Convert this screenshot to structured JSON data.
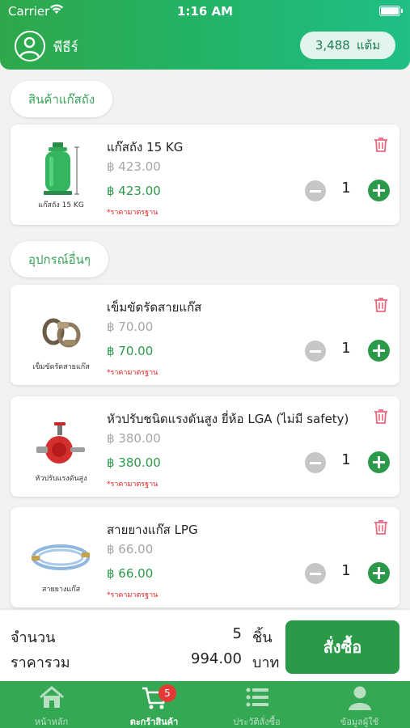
{
  "status_bar": {
    "carrier": "Carrier",
    "time": "1:16 AM"
  },
  "header": {
    "user_name": "พีธีร์",
    "points_value": "3,488",
    "points_unit": "แต้ม"
  },
  "sections": [
    {
      "title": "สินค้าแก๊สถัง"
    },
    {
      "title": "อุปกรณ์อื่นๆ"
    }
  ],
  "items": [
    {
      "name": "แก๊สถัง 15 KG",
      "old_price": "฿ 423.00",
      "price": "฿ 423.00",
      "note": "*ราคามาตรฐาน",
      "qty": "1",
      "img_caption": "แก๊สถัง 15 KG"
    },
    {
      "name": "เข็มขัดรัดสายแก๊ส",
      "old_price": "฿ 70.00",
      "price": "฿ 70.00",
      "note": "*ราคามาตรฐาน",
      "qty": "1",
      "img_caption": "เข็มขัดรัดสายแก๊ส"
    },
    {
      "name": "หัวปรับชนิดแรงดันสูง ยี่ห้อ LGA (ไม่มี safety)",
      "old_price": "฿ 380.00",
      "price": "฿ 380.00",
      "note": "*ราคามาตรฐาน",
      "qty": "1",
      "img_caption": "หัวปรับแรงดันสูง"
    },
    {
      "name": "สายยางแก๊ส LPG",
      "old_price": "฿ 66.00",
      "price": "฿ 66.00",
      "note": "*ราคามาตรฐาน",
      "qty": "1",
      "img_caption": "สายยางแก๊ส"
    }
  ],
  "summary": {
    "qty_label": "จำนวน",
    "qty_value": "5",
    "qty_unit": "ชิ้น",
    "total_label": "ราคารวม",
    "total_value": "994.00",
    "total_unit": "บาท",
    "order_button": "สั่งซื้อ"
  },
  "tabs": [
    {
      "label": "หน้าหลัก",
      "icon": "home-icon"
    },
    {
      "label": "ตะกร้าสินค้า",
      "icon": "cart-icon",
      "badge": "5"
    },
    {
      "label": "ประวัติสั่งซื้อ",
      "icon": "list-icon"
    },
    {
      "label": "ข้อมูลผู้ใช้",
      "icon": "person-icon"
    }
  ],
  "colors": {
    "primary": "#2a9a48",
    "header_gradient_end": "#1fbf86",
    "badge_red": "#e53935",
    "note_red": "#e02020"
  }
}
